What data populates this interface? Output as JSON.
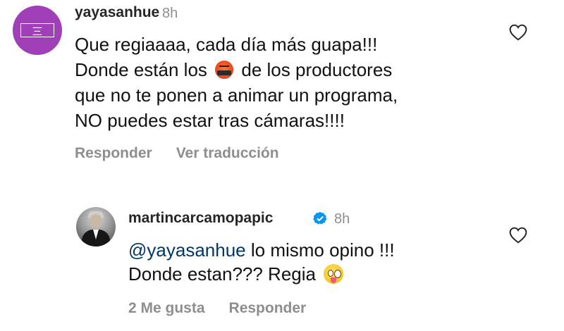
{
  "comments": [
    {
      "username": "yayasanhue",
      "time": "8h",
      "text_line1": "Que regiaaaa, cada día más guapa!!!",
      "text_line2_a": "Donde están los",
      "text_line2_b": "de los productores",
      "text_line3": "que no te ponen a animar un programa,",
      "text_line4": "NO puedes estar tras cámaras!!!!",
      "actions": {
        "reply": "Responder",
        "translate": "Ver traducción"
      },
      "avatar_icon": "purple-logo-avatar",
      "emoji_icon": "rage-face-emoji"
    },
    {
      "username": "martincarcamopapic",
      "verified": true,
      "time": "8h",
      "mention": "@yayasanhue",
      "text_line1_rest": "lo mismo opino !!!",
      "text_line2": "Donde estan??? Regia",
      "actions": {
        "likes": "2 Me gusta",
        "reply": "Responder"
      },
      "avatar_icon": "profile-photo-avatar",
      "emoji_icon": "winking-tongue-emoji"
    }
  ],
  "colors": {
    "username": "#262626",
    "muted": "#8e8e8e",
    "mention": "#00376b",
    "verified": "#0095f6"
  }
}
